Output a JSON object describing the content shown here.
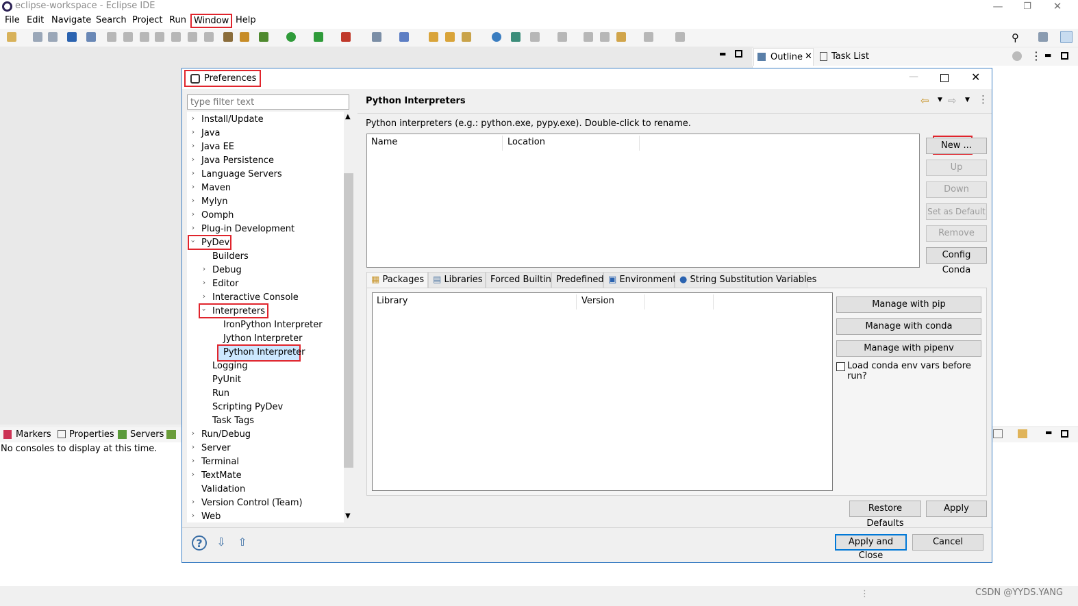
{
  "window": {
    "title": "eclipse-workspace - Eclipse IDE",
    "minimize": "—",
    "restore": "❐",
    "close": "✕"
  },
  "menu": [
    "File",
    "Edit",
    "Navigate",
    "Search",
    "Project",
    "Run",
    "Window",
    "Help"
  ],
  "outline_tabs": {
    "outline": "Outline",
    "task_list": "Task List"
  },
  "bottom_tabs": {
    "markers": "Markers",
    "properties": "Properties",
    "servers": "Servers"
  },
  "console_message": "No consoles to display at this time.",
  "dialog": {
    "title": "Preferences",
    "filter_placeholder": "type filter text",
    "tree": [
      "Install/Update",
      "Java",
      "Java EE",
      "Java Persistence",
      "Language Servers",
      "Maven",
      "Mylyn",
      "Oomph",
      "Plug-in Development",
      "PyDev",
      "Builders",
      "Debug",
      "Editor",
      "Interactive Console",
      "Interpreters",
      "IronPython Interpreter",
      "Jython Interpreter",
      "Python Interpreter",
      "Logging",
      "PyUnit",
      "Run",
      "Scripting PyDev",
      "Task Tags",
      "Run/Debug",
      "Server",
      "Terminal",
      "TextMate",
      "Validation",
      "Version Control (Team)",
      "Web"
    ],
    "page_title": "Python Interpreters",
    "description": "Python interpreters (e.g.: python.exe, pypy.exe).   Double-click to rename.",
    "interp_columns": [
      "Name",
      "Location"
    ],
    "side_buttons": {
      "new": "New ...",
      "up": "Up",
      "down": "Down",
      "set_default": "Set as Default",
      "remove": "Remove",
      "config_conda": "Config Conda"
    },
    "tabs": [
      "Packages",
      "Libraries",
      "Forced Builtins",
      "Predefined",
      "Environment",
      "String Substitution Variables"
    ],
    "lib_columns": [
      "Library",
      "Version"
    ],
    "manage_buttons": {
      "pip": "Manage with pip",
      "conda": "Manage with conda",
      "pipenv": "Manage with pipenv"
    },
    "checkbox_label": "Load conda env vars before run?",
    "restore_defaults": "Restore Defaults",
    "apply": "Apply",
    "apply_close": "Apply and Close",
    "cancel": "Cancel"
  },
  "watermark": "CSDN @YYDS.YANG",
  "colors": {
    "highlight_red": "#e0242c",
    "selection_blue": "#cce8ff",
    "focus_blue": "#0078d7"
  }
}
